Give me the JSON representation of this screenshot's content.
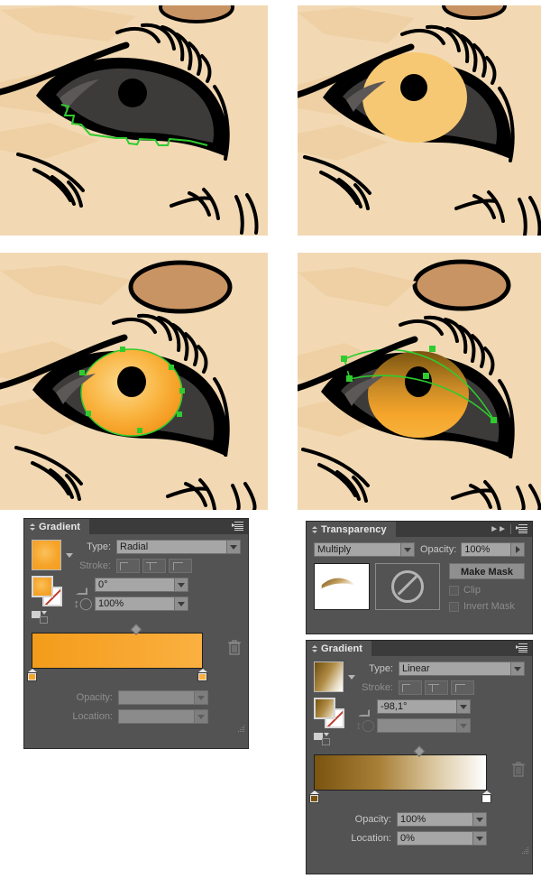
{
  "illustrations": [
    {
      "id": "step1",
      "caption_alt": "cat eye with dark iris and green path outline on lower lid"
    },
    {
      "id": "step2",
      "caption_alt": "cat eye with flat yellow iris"
    },
    {
      "id": "step3",
      "caption_alt": "cat eye with radial orange gradient iris and green anchor points"
    },
    {
      "id": "step4",
      "caption_alt": "cat eye with linear gradient shading and green gradient annotator"
    }
  ],
  "gradient_panel_left": {
    "title": "Gradient",
    "type_label": "Type:",
    "type_value": "Radial",
    "stroke_label": "Stroke:",
    "angle_value": "0°",
    "aspect_value": "100%",
    "opacity_label": "Opacity:",
    "opacity_value": "",
    "location_label": "Location:",
    "location_value": "",
    "stop_start_color": "#f39c1b",
    "stop_end_color": "#fbb040",
    "swatch_center": "#fcc15a",
    "swatch_edge": "#f39c1b"
  },
  "transparency_panel": {
    "title": "Transparency",
    "blend_mode": "Multiply",
    "opacity_label": "Opacity:",
    "opacity_value": "100%",
    "make_mask_label": "Make Mask",
    "clip_label": "Clip",
    "invert_mask_label": "Invert Mask"
  },
  "gradient_panel_right": {
    "title": "Gradient",
    "type_label": "Type:",
    "type_value": "Linear",
    "stroke_label": "Stroke:",
    "angle_value": "-98,1°",
    "aspect_value": "",
    "opacity_label": "Opacity:",
    "opacity_value": "100%",
    "location_label": "Location:",
    "location_value": "0%",
    "stop_start_color": "#7a5410",
    "stop_end_color": "#ffffff",
    "swatch_start": "#6f4e10",
    "swatch_end": "#ffffff"
  },
  "theme": {
    "panel_bg": "#535353",
    "panel_header_bg": "#3b3b3b",
    "field_bg": "#a6a6a6",
    "text": "#d4d4d4",
    "text_dim": "#8e8e8e",
    "skin": "#f2d9b3",
    "iris_yellow": "#f7c873",
    "iris_orange": "#f7941e",
    "path_green": "#2ecc2e"
  }
}
